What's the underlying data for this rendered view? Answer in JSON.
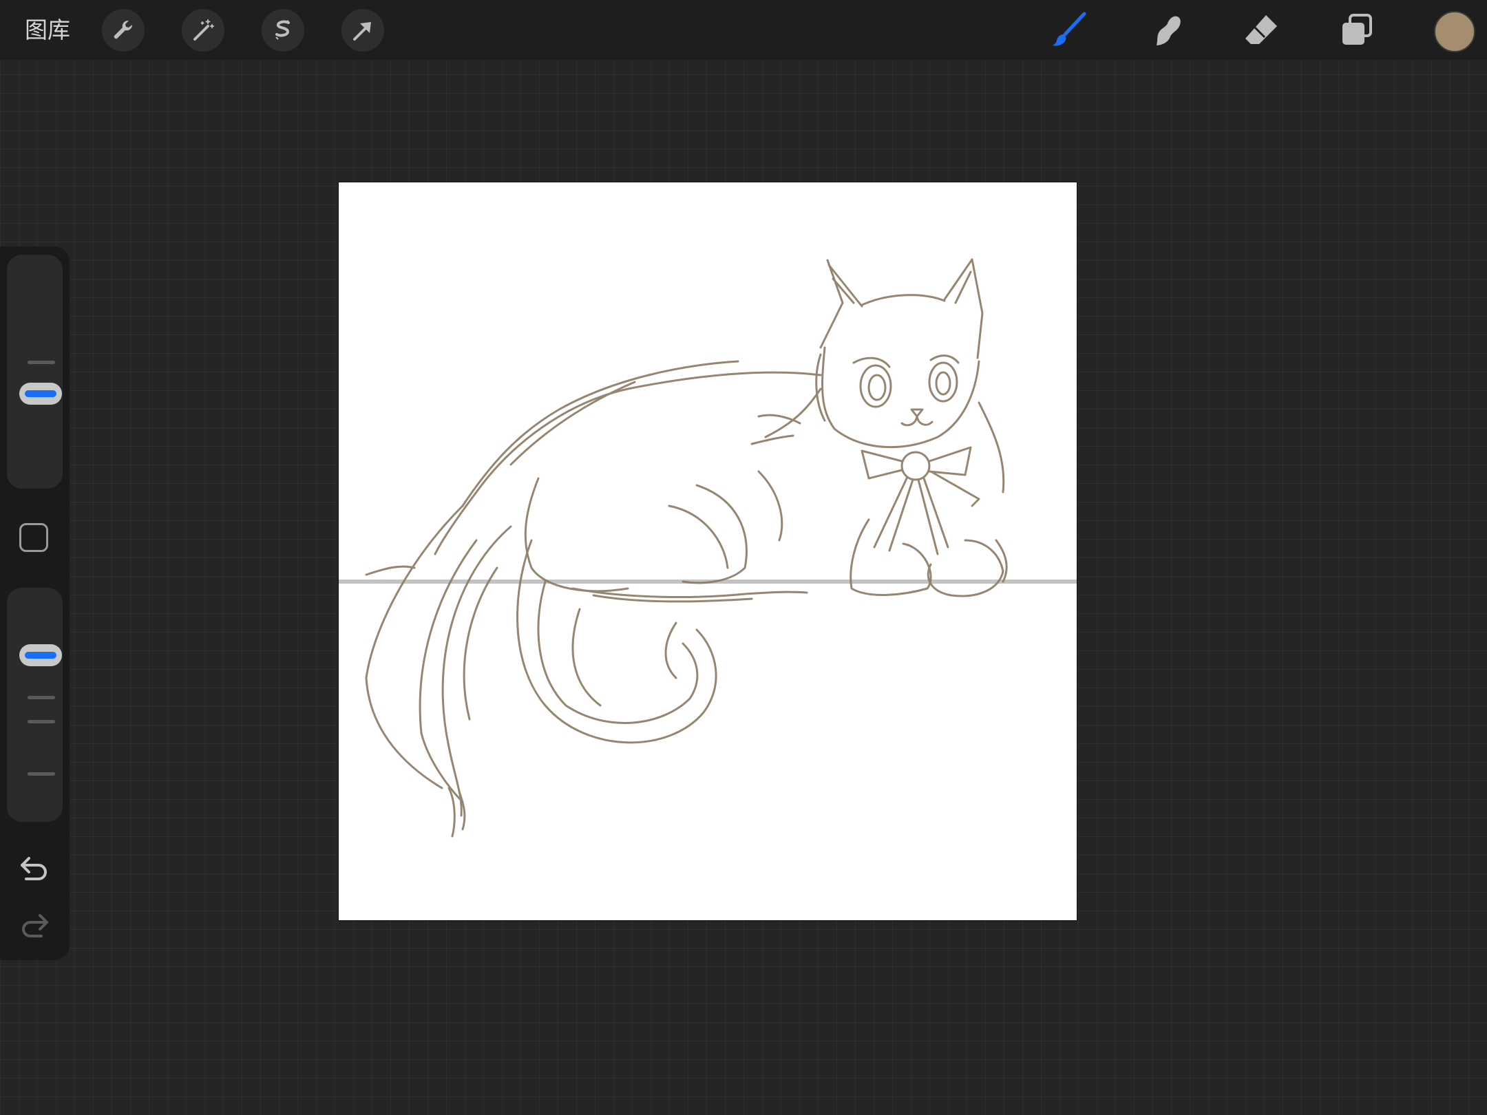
{
  "topbar": {
    "gallery_label": "图库",
    "left_tools": [
      {
        "name": "actions",
        "icon": "wrench-icon"
      },
      {
        "name": "adjustments",
        "icon": "magic-wand-icon"
      },
      {
        "name": "selection",
        "icon": "selection-s-icon"
      },
      {
        "name": "transform",
        "icon": "arrow-cursor-icon"
      }
    ],
    "right_tools": [
      {
        "name": "paint",
        "icon": "brush-icon",
        "active": true
      },
      {
        "name": "smudge",
        "icon": "smudge-finger-icon",
        "active": false
      },
      {
        "name": "erase",
        "icon": "eraser-icon",
        "active": false
      },
      {
        "name": "layers",
        "icon": "layers-icon",
        "active": false
      }
    ],
    "current_color": "#a58e6f"
  },
  "sidebar": {
    "brush_size_level": 0.6,
    "opacity_level": 0.75,
    "modify_icon": "square-icon",
    "undo_icon": "undo-arrow-icon",
    "redo_icon": "redo-arrow-icon"
  },
  "canvas": {
    "background": "#ffffff",
    "stroke_color": "#8b7a62",
    "horizon_color": "#bdbdbd",
    "artwork": "cat sketch"
  },
  "colors": {
    "accent": "#1a6df5",
    "toolbar_bg": "#1e1e1e",
    "workspace_bg": "#252525"
  }
}
